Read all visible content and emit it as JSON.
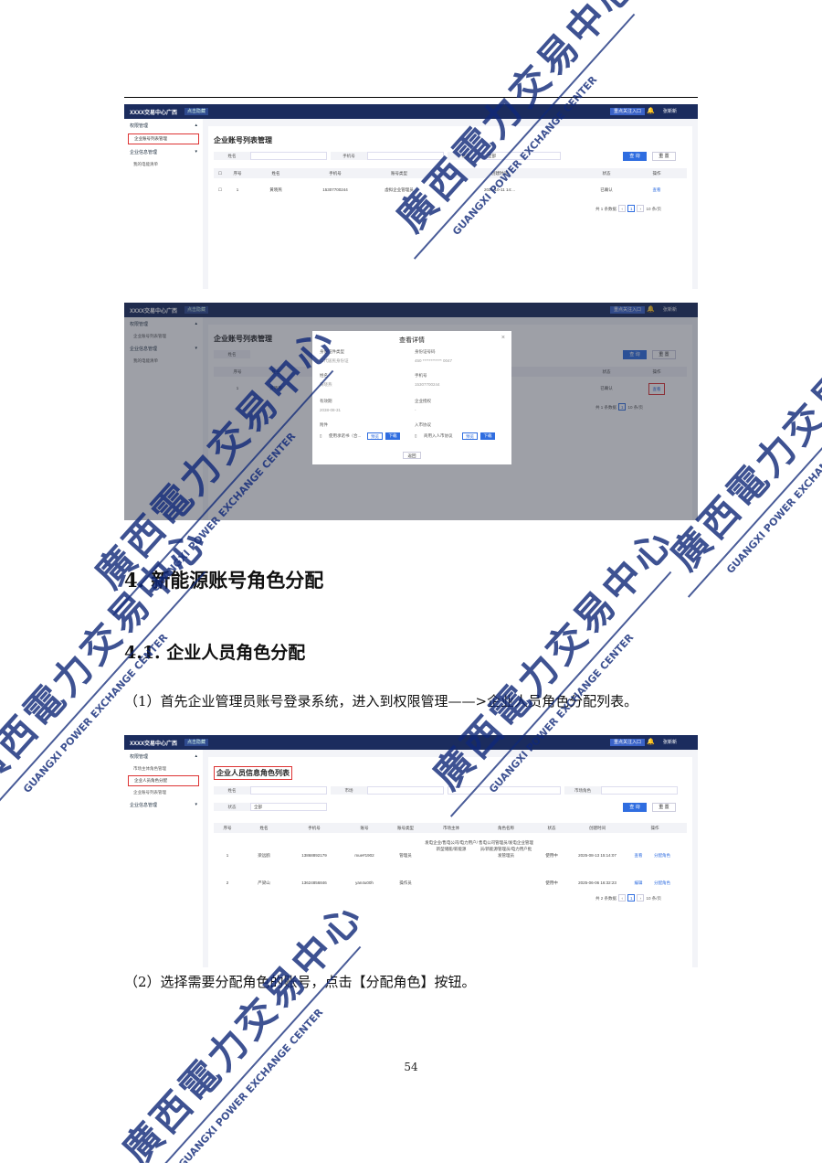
{
  "shot1": {
    "app": "XXXX交易中心广西",
    "tag": "点击隐藏",
    "badge_btn": "重点关注入口",
    "user": "张新新",
    "menu": [
      "权限管理",
      "企业账号列表管理",
      "企业信息管理",
      "我的电能清单"
    ],
    "title": "企业账号列表管理",
    "labels": [
      "姓名",
      "手机号",
      "状态"
    ],
    "status": "全部",
    "btn_query": "查 询",
    "btn_reset": "重 置",
    "headers": [
      "序号",
      "姓名",
      "手机号",
      "账号类型",
      "创建时间",
      "状态",
      "操作"
    ],
    "row": [
      "1",
      "黄晓燕",
      "15307700244",
      "虚拟企业管理员",
      "2025-10-11 14:...",
      "已确认",
      "查看"
    ],
    "pager": "共 1 条数据",
    "page": "1",
    "per": "10 条/页"
  },
  "shot2": {
    "modal_title": "查看详情",
    "fields": [
      [
        "身份证件类型",
        "二代居民身份证"
      ],
      [
        "身份证号码",
        "450 ************ 0047"
      ],
      [
        "姓名",
        "黄晓燕"
      ],
      [
        "手机号",
        "15307700244"
      ],
      [
        "有效期",
        "2038-08-31"
      ],
      [
        "企业授权",
        "-"
      ],
      [
        "附件",
        ""
      ],
      [
        "入市协议",
        ""
      ]
    ],
    "file1": "使用承诺书（合...",
    "file2": "商用入人市协议",
    "preview": "预览",
    "download": "下载",
    "back": "返回",
    "title": "企业账号列表管理",
    "op": "查看"
  },
  "heading1": "4. 新能源账号角色分配",
  "heading2": "4.1.  企业人员角色分配",
  "para1": "（1）首先企业管理员账号登录系统，进入到权限管理——>企业人员角色分配列表。",
  "shot3": {
    "menu": [
      "权限管理",
      "市场主体角色管理",
      "企业人员角色分配",
      "企业账号列表管理",
      "企业信息管理"
    ],
    "title": "企业人员信息角色列表",
    "labels": [
      "姓名",
      "市场",
      "状态",
      "市场角色"
    ],
    "status": "全部",
    "btn_query": "查 询",
    "btn_reset": "重 置",
    "headers": [
      "序号",
      "姓名",
      "手机号",
      "账号",
      "账号类型",
      "市场主体",
      "角色名称",
      "状态",
      "创建时间",
      "操作"
    ],
    "rows": [
      [
        "1",
        "梁远鸥",
        "13868892179",
        "mue#1902",
        "管理员",
        "发电企业/售电公司/电力用户/新型储能/新能源",
        "售电公司管理员/发电企业管理员/新能源管理员/电力用户批发管理员",
        "使用中",
        "2025-08-13 15:14:07",
        "查看",
        "分配角色"
      ],
      [
        "2",
        "严梁山",
        "13624856846",
        "yan4u00h",
        "操作员",
        "",
        "",
        "使用中",
        "2025-06-06 16:32:23",
        "编辑",
        "分配角色"
      ]
    ],
    "pager": "共 2 条数据",
    "page": "1",
    "per": "10 条/页"
  },
  "para2": "（2）选择需要分配角色的账号，点击【分配角色】按钮。",
  "page_number": "54",
  "watermark": {
    "chars": "廣西電力交易中心",
    "en": "GUANGXI POWER EXCHANGE CENTER",
    "color": "#0f2878"
  }
}
